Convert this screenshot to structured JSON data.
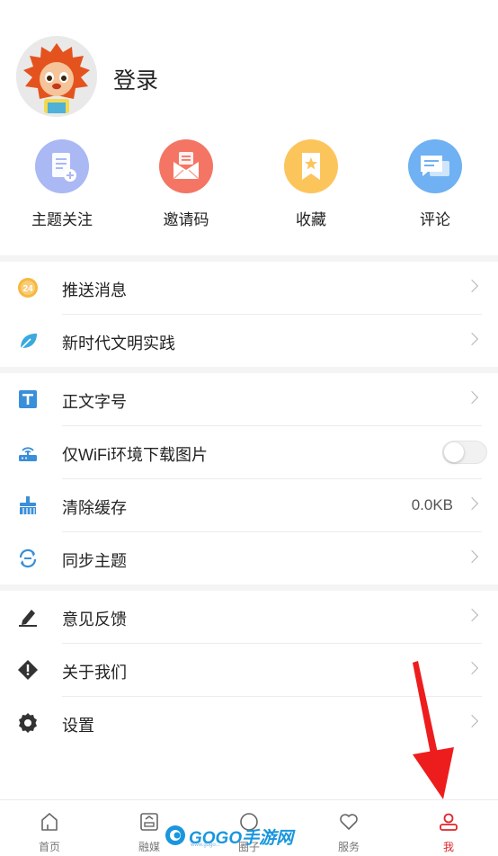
{
  "profile": {
    "login_label": "登录"
  },
  "quick_actions": [
    {
      "label": "主题关注",
      "icon": "document-add-icon",
      "color": "#aab8f4"
    },
    {
      "label": "邀请码",
      "icon": "envelope-icon",
      "color": "#f47564"
    },
    {
      "label": "收藏",
      "icon": "bookmark-icon",
      "color": "#fcc55c"
    },
    {
      "label": "评论",
      "icon": "chat-icon",
      "color": "#6fb1f2"
    }
  ],
  "settings": {
    "push": {
      "label": "推送消息",
      "icon": "clock-24-icon"
    },
    "civilization": {
      "label": "新时代文明实践",
      "icon": "leaf-icon"
    },
    "font_size": {
      "label": "正文字号",
      "icon": "text-t-icon"
    },
    "wifi_images": {
      "label": "仅WiFi环境下载图片",
      "icon": "router-icon",
      "enabled": false
    },
    "clear_cache": {
      "label": "清除缓存",
      "icon": "broom-icon",
      "value": "0.0KB"
    },
    "sync_theme": {
      "label": "同步主题",
      "icon": "sync-icon"
    },
    "feedback": {
      "label": "意见反馈",
      "icon": "pencil-icon"
    },
    "about": {
      "label": "关于我们",
      "icon": "info-diamond-icon"
    },
    "settings": {
      "label": "设置",
      "icon": "gear-icon"
    }
  },
  "tabbar": {
    "active_color": "#e0262a",
    "items": [
      {
        "label": "首页",
        "icon": "home-icon"
      },
      {
        "label": "融媒",
        "icon": "media-icon"
      },
      {
        "label": "圈子",
        "icon": "circle-icon"
      },
      {
        "label": "服务",
        "icon": "heart-icon"
      },
      {
        "label": "我",
        "icon": "user-icon",
        "active": true
      }
    ]
  },
  "watermark": {
    "text": "GOGO手游网",
    "sub": "www.gogo..."
  }
}
